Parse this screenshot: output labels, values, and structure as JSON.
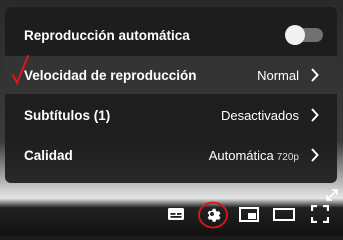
{
  "settings_menu": {
    "items": [
      {
        "label": "Reproducción automática",
        "value": "",
        "type": "toggle",
        "toggle_on": false
      },
      {
        "label": "Velocidad de reproducción",
        "value": "Normal",
        "type": "submenu"
      },
      {
        "label": "Subtítulos",
        "count": "(1)",
        "value": "Desactivados",
        "type": "submenu"
      },
      {
        "label": "Calidad",
        "value": "Automática",
        "resolution": "720p",
        "type": "submenu"
      }
    ]
  },
  "controls": {
    "icons": [
      "subtitles-icon",
      "settings-gear-icon",
      "miniplayer-icon",
      "theater-mode-icon",
      "fullscreen-icon"
    ]
  },
  "colors": {
    "menu_bg": "#1c1c1c",
    "annotation_red": "#e0141e",
    "toggle_track": "#717171"
  }
}
